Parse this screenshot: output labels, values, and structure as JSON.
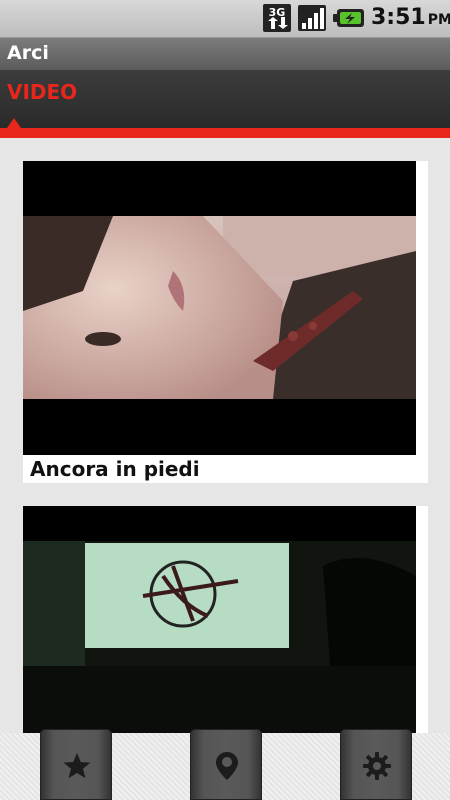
{
  "status_bar": {
    "network": "3G",
    "time": "3:51",
    "ampm": "PM"
  },
  "app": {
    "title": "Arci"
  },
  "tabs": [
    {
      "label": "VIDEO",
      "selected": true
    }
  ],
  "colors": {
    "accent": "#e8261b",
    "tab_bg": "#2f2f2f",
    "title_bar": "#6a6a6a"
  },
  "videos": [
    {
      "title": "Ancora in piedi",
      "thumbnail": "woman-lying-closeup"
    },
    {
      "title": "",
      "thumbnail": "projection-screen-dark-room"
    }
  ],
  "bottom_nav": [
    {
      "icon": "star-icon"
    },
    {
      "icon": "map-pin-icon"
    },
    {
      "icon": "gear-icon"
    }
  ]
}
